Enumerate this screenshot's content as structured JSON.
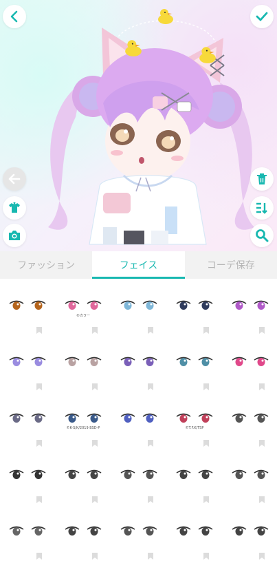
{
  "toolbar": {
    "back_icon": "chevron-left-icon",
    "confirm_icon": "check-icon",
    "undo_icon": "arrow-left-icon",
    "wardrobe_icon": "shirt-icon",
    "camera_icon": "camera-icon",
    "trash_icon": "trash-icon",
    "sort_icon": "sort-icon",
    "search_icon": "search-icon"
  },
  "tabs": [
    {
      "label": "ファッション",
      "active": false
    },
    {
      "label": "フェイス",
      "active": true
    },
    {
      "label": "コーデ保存",
      "active": false
    }
  ],
  "eye_items": [
    {
      "iris": "#b5651d",
      "credit": ""
    },
    {
      "iris": "#e0679b",
      "credit": "©カラー"
    },
    {
      "iris": "#7fb7d8",
      "credit": ""
    },
    {
      "iris": "#2f3b5c",
      "credit": ""
    },
    {
      "iris": "#b05ac8",
      "credit": ""
    },
    {
      "iris": "#9a8ce0",
      "credit": ""
    },
    {
      "iris": "#b9a2a2",
      "credit": ""
    },
    {
      "iris": "#7a5fb8",
      "credit": ""
    },
    {
      "iris": "#4f8fa6",
      "credit": ""
    },
    {
      "iris": "#e0488a",
      "credit": ""
    },
    {
      "iris": "#6a6a86",
      "credit": ""
    },
    {
      "iris": "#3a5a8a",
      "credit": "©K-S/K/2019 BSD-P"
    },
    {
      "iris": "#5060c0",
      "credit": ""
    },
    {
      "iris": "#c0405a",
      "credit": "©T.F.K/TSP"
    },
    {
      "iris": "#555555",
      "credit": ""
    },
    {
      "iris": "#333333",
      "credit": ""
    },
    {
      "iris": "#444444",
      "credit": ""
    },
    {
      "iris": "#555555",
      "credit": ""
    },
    {
      "iris": "#444444",
      "credit": ""
    },
    {
      "iris": "#555555",
      "credit": ""
    },
    {
      "iris": "#666666",
      "credit": ""
    },
    {
      "iris": "#444444",
      "credit": ""
    },
    {
      "iris": "#555555",
      "credit": ""
    },
    {
      "iris": "#444444",
      "credit": ""
    },
    {
      "iris": "#444444",
      "credit": ""
    }
  ],
  "colors": {
    "accent": "#18b8b0",
    "tab_bg": "#f2f2f2",
    "tab_inactive": "#b5b5b5"
  }
}
